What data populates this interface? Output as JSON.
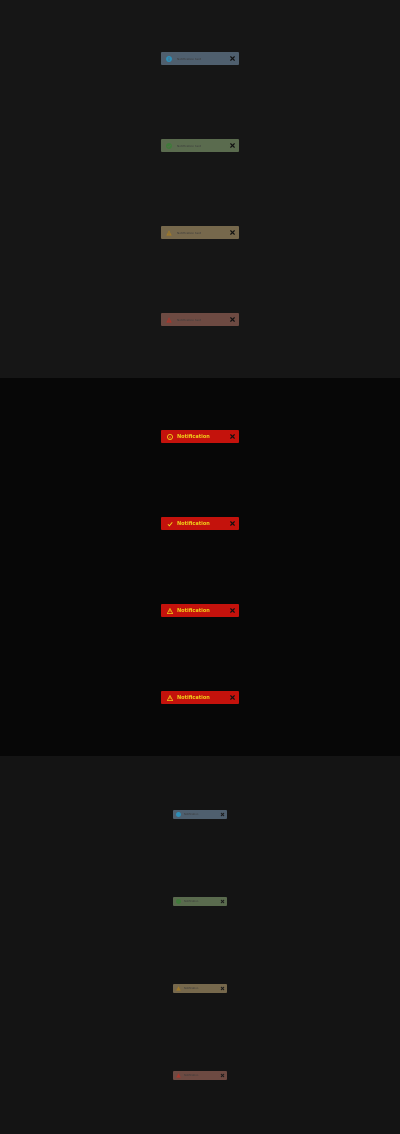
{
  "colors": {
    "info": "#4f5f6e",
    "success": "#5a6b4e",
    "warning": "#76684c",
    "error": "#6d4a42",
    "contrast_bg": "#c4120c",
    "contrast_text": "#f1d21a"
  },
  "default_set": {
    "toasts": [
      {
        "variant": "info",
        "icon": "info-icon",
        "message": "Notification text",
        "close_icon": "close-icon"
      },
      {
        "variant": "success",
        "icon": "check-circle-icon",
        "message": "Notification text",
        "close_icon": "close-icon"
      },
      {
        "variant": "warning",
        "icon": "warning-icon",
        "message": "Notification text",
        "close_icon": "close-icon"
      },
      {
        "variant": "error",
        "icon": "error-icon",
        "message": "Notification text",
        "close_icon": "close-icon"
      }
    ]
  },
  "high_contrast_set": {
    "toasts": [
      {
        "variant": "info",
        "icon": "info-icon",
        "message": "Notification",
        "close_icon": "close-icon"
      },
      {
        "variant": "success",
        "icon": "check-icon",
        "message": "Notification",
        "close_icon": "close-icon"
      },
      {
        "variant": "warning",
        "icon": "warning-icon",
        "message": "Notification",
        "close_icon": "close-icon"
      },
      {
        "variant": "error",
        "icon": "error-icon",
        "message": "Notification",
        "close_icon": "close-icon"
      }
    ]
  },
  "small_set": {
    "toasts": [
      {
        "variant": "info",
        "icon": "info-icon",
        "message": "Notification",
        "close_icon": "close-icon"
      },
      {
        "variant": "success",
        "icon": "check-circle-icon",
        "message": "Notification",
        "close_icon": "close-icon"
      },
      {
        "variant": "warning",
        "icon": "warning-icon",
        "message": "Notification",
        "close_icon": "close-icon"
      },
      {
        "variant": "error",
        "icon": "error-icon",
        "message": "Notification",
        "close_icon": "close-icon"
      }
    ]
  }
}
